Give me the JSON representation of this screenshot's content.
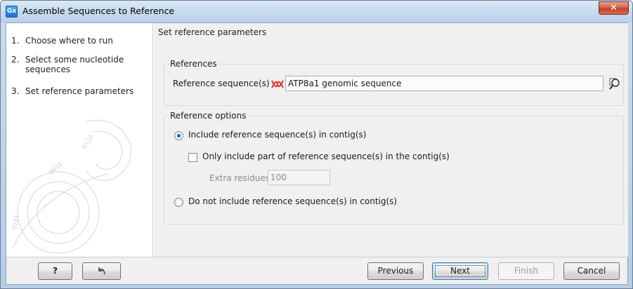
{
  "window": {
    "title": "Assemble Sequences to Reference",
    "app_icon_text": "Gx",
    "close_glyph": "✕"
  },
  "steps": [
    {
      "num": "1.",
      "label": "Choose where to run"
    },
    {
      "num": "2.",
      "label": "Select some nucleotide sequences"
    },
    {
      "num": "3.",
      "label": "Set reference parameters"
    }
  ],
  "main": {
    "header": "Set reference parameters",
    "references": {
      "group_title": "References",
      "field_label": "Reference sequence(s)",
      "field_value": "ATP8a1 genomic sequence",
      "field_icon": "dna-sequence-icon",
      "browse_icon": "browse-magnifier-icon"
    },
    "options": {
      "group_title": "Reference options",
      "include_radio_label": "Include reference sequence(s) in contig(s)",
      "include_selected": true,
      "partial_checkbox_label": "Only include part of reference sequence(s) in the contig(s)",
      "partial_checked": false,
      "extra_residues_label": "Extra residues",
      "extra_residues_value": "100",
      "exclude_radio_label": "Do not include reference sequence(s) in contig(s)",
      "exclude_selected": false
    }
  },
  "footer": {
    "help_label": "?",
    "reset_icon": "reset-arrow-icon",
    "previous_label": "Previous",
    "next_label": "Next",
    "finish_label": "Finish",
    "cancel_label": "Cancel"
  },
  "colors": {
    "accent": "#2a5ea8",
    "close": "#c4412c",
    "dna_icon": "#d23a2a"
  }
}
